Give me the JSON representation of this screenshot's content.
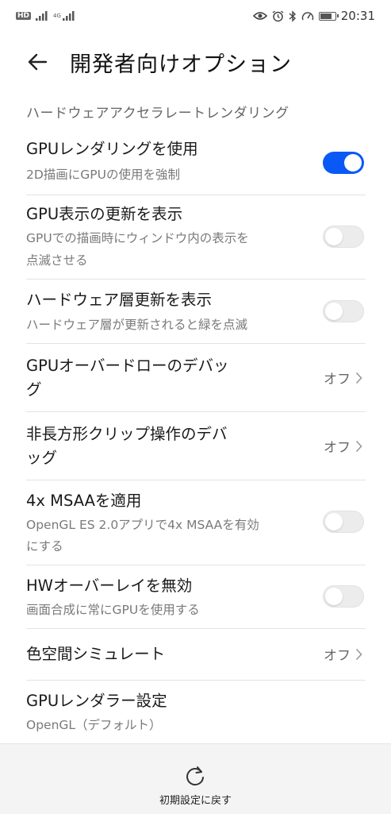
{
  "status_bar": {
    "hd_badge": "HD",
    "network_type": "4G",
    "time": "20:31",
    "battery_level": 0.8
  },
  "header": {
    "title": "開発者向けオプション"
  },
  "section_title": "ハードウェアアクセラレートレンダリング",
  "items": [
    {
      "title": "GPUレンダリングを使用",
      "subtitle": "2D描画にGPUの使用を強制",
      "toggle": "on"
    },
    {
      "title": "GPU表示の更新を表示",
      "subtitle_line1": "GPUでの描画時にウィンドウ内の表示を",
      "subtitle_line2": "点滅させる",
      "toggle": "off"
    },
    {
      "title": "ハードウェア層更新を表示",
      "subtitle": "ハードウェア層が更新されると緑を点滅",
      "toggle": "off"
    },
    {
      "title_line1": "GPUオーバードローのデバッ",
      "title_line2": "グ",
      "value": "オフ"
    },
    {
      "title_line1": "非長方形クリップ操作のデバ",
      "title_line2": "ッグ",
      "value": "オフ"
    },
    {
      "title": "4x MSAAを適用",
      "subtitle_line1": "OpenGL ES 2.0アプリで4x MSAAを有効",
      "subtitle_line2": "にする",
      "toggle": "off"
    },
    {
      "title": "HWオーバーレイを無効",
      "subtitle": "画面合成に常にGPUを使用する",
      "toggle": "off"
    },
    {
      "title": "色空間シミュレート",
      "value": "オフ"
    },
    {
      "title": "GPUレンダラー設定",
      "subtitle": "OpenGL（デフォルト）"
    }
  ],
  "footer": {
    "reset_label": "初期設定に戻す"
  },
  "colors": {
    "accent": "#0a59f7",
    "toggle_off": "#ececec",
    "footer_bg": "#f4f4f4"
  }
}
